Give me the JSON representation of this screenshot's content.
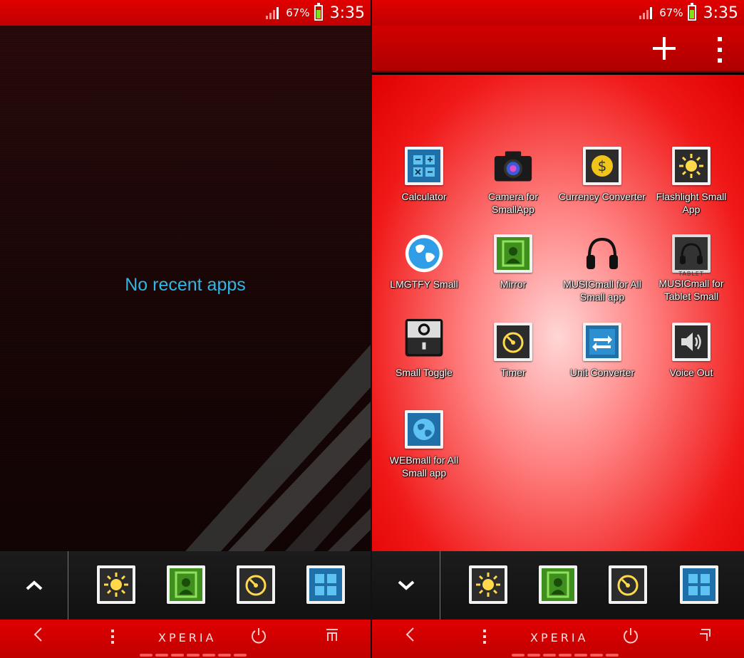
{
  "status": {
    "battery_pct": "67%",
    "time": "3:35"
  },
  "left": {
    "empty_message": "No recent apps",
    "dock_toggle": "^"
  },
  "right": {
    "apps": [
      {
        "label": "Calculator",
        "icon": "calculator-icon"
      },
      {
        "label": "Camera for SmallApp",
        "icon": "camera-icon"
      },
      {
        "label": "Currency Converter",
        "icon": "currency-icon"
      },
      {
        "label": "Flashlight Small App",
        "icon": "flashlight-icon"
      },
      {
        "label": "LMGTFY Small",
        "icon": "globe-icon"
      },
      {
        "label": "Mirror",
        "icon": "mirror-icon"
      },
      {
        "label": "MUSICmall for All Small app",
        "icon": "headphones-icon"
      },
      {
        "label": "MUSICmall for Tablet Small",
        "icon": "tablet-headphones-icon"
      },
      {
        "label": "Small Toggle",
        "icon": "toggle-icon"
      },
      {
        "label": "Timer",
        "icon": "timer-icon"
      },
      {
        "label": "Unit Converter",
        "icon": "unit-converter-icon"
      },
      {
        "label": "Voice Out",
        "icon": "speaker-icon"
      },
      {
        "label": "WEBmall for All Small app",
        "icon": "web-globe-icon"
      }
    ],
    "tablet_tag": "TABLET",
    "dock_toggle": "⌄"
  },
  "nav": {
    "brand": "XPERIA"
  },
  "colors": {
    "accent": "#e00000",
    "recent_text": "#33b5e5"
  }
}
